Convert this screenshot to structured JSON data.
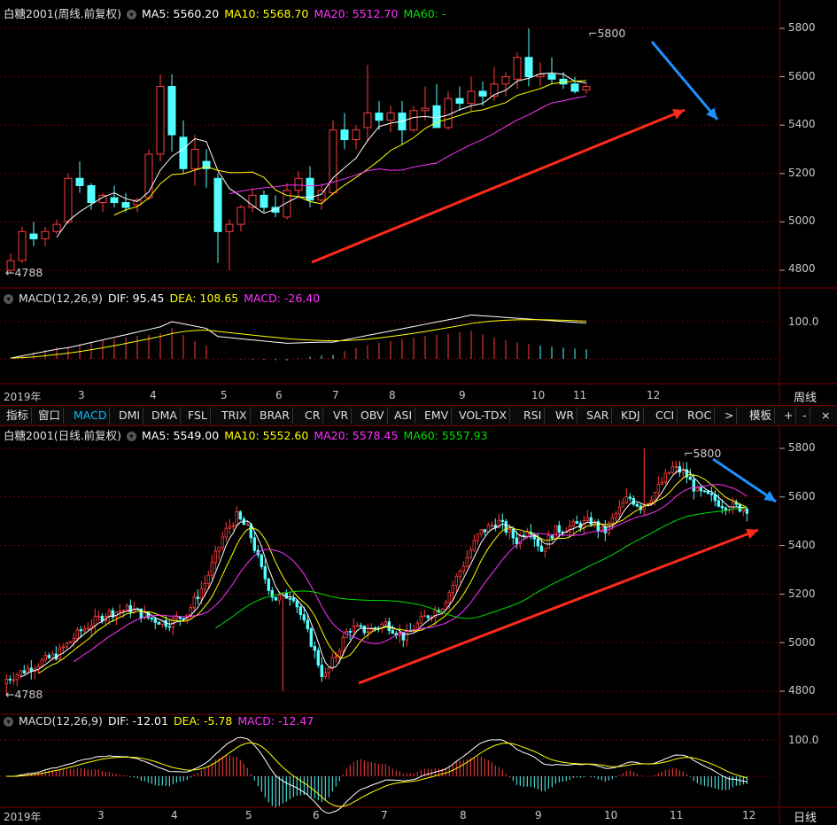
{
  "weekly": {
    "title": "白糖2001(周线.前复权)",
    "ma5": "MA5: 5560.20",
    "ma10": "MA10: 5568.70",
    "ma20": "MA20: 5512.70",
    "ma60": "MA60: -",
    "high_label": "5800",
    "low_label": "4788",
    "y_ticks": [
      "5800",
      "5600",
      "5400",
      "5200",
      "5000",
      "4800"
    ],
    "macd_title": "MACD(12,26,9)",
    "dif": "DIF: 95.45",
    "dea": "DEA: 108.65",
    "macd": "MACD: -26.40",
    "macd_tick": "100.0",
    "x_year": "2019年",
    "x_months": [
      "3",
      "4",
      "5",
      "6",
      "7",
      "8",
      "9",
      "10",
      "11",
      "12"
    ],
    "period_label": "周线"
  },
  "tabs": [
    "指标",
    "窗口",
    "MACD",
    "DMI",
    "DMA",
    "FSL",
    "TRIX",
    "BRAR",
    "CR",
    "VR",
    "OBV",
    "ASI",
    "EMV",
    "VOL-TDX",
    "RSI",
    "WR",
    "SAR",
    "KDJ",
    "CCI",
    "ROC",
    ">"
  ],
  "right_tools": {
    "template": "模板",
    "plus": "+",
    "minus": "-",
    "close": "×"
  },
  "daily": {
    "title": "白糖2001(日线.前复权)",
    "ma5": "MA5: 5549.00",
    "ma10": "MA10: 5552.60",
    "ma20": "MA20: 5578.45",
    "ma60": "MA60: 5557.93",
    "high_label": "5800",
    "low_label": "4788",
    "y_ticks": [
      "5800",
      "5600",
      "5400",
      "5200",
      "5000",
      "4800"
    ],
    "macd_title": "MACD(12,26,9)",
    "dif": "DIF: -12.01",
    "dea": "DEA: -5.78",
    "macd": "MACD: -12.47",
    "macd_tick": "100.0",
    "x_year": "2019年",
    "x_months": [
      "3",
      "4",
      "5",
      "6",
      "7",
      "8",
      "9",
      "10",
      "11",
      "12"
    ],
    "period_label": "日线"
  },
  "colors": {
    "up": "#ff3c3c",
    "down": "#54ffff",
    "ma5": "#ffffff",
    "ma10": "#ffff00",
    "ma20": "#ff33ff",
    "ma60": "#00e000",
    "grid": "#7a0000",
    "arrow_red": "#ff2a1a",
    "arrow_blue": "#1e8fff"
  }
}
